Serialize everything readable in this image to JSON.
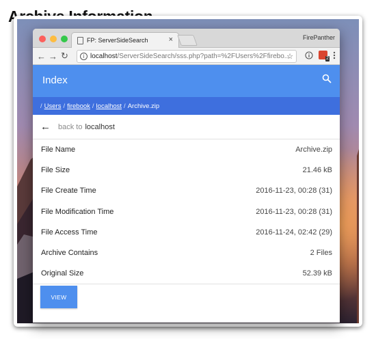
{
  "caption": "Archive Information",
  "browser": {
    "tab_title": "FP: ServerSideSearch",
    "tab_close": "×",
    "profile_name": "FirePanther",
    "url_host": "localhost",
    "url_path": "/ServerSideSearch/sss.php?path=%2FUsers%2Ffirebo...",
    "extension_badge": "2"
  },
  "app": {
    "title": "Index",
    "accent_color": "#4e8fee",
    "breadcrumb_color": "#3e6fde"
  },
  "breadcrumb": {
    "items": [
      "Users",
      "firebook",
      "localhost",
      "Archive.zip"
    ]
  },
  "back": {
    "prefix": "back to",
    "target": "localhost"
  },
  "details": [
    {
      "label": "File Name",
      "value": "Archive.zip"
    },
    {
      "label": "File Size",
      "value": "21.46 kB"
    },
    {
      "label": "File Create Time",
      "value": "2016-11-23, 00:28 (31)"
    },
    {
      "label": "File Modification Time",
      "value": "2016-11-23, 00:28 (31)"
    },
    {
      "label": "File Access Time",
      "value": "2016-11-24, 02:42 (29)"
    },
    {
      "label": "Archive Contains",
      "value": "2 Files"
    },
    {
      "label": "Original Size",
      "value": "52.39 kB"
    }
  ],
  "actions": {
    "view_label": "VIEW"
  },
  "icons": {
    "back": "arrow-left-icon",
    "forward": "arrow-right-icon",
    "reload": "reload-icon",
    "search": "search-icon",
    "star": "star-icon",
    "info": "info-icon",
    "menu": "more-vert-icon"
  }
}
